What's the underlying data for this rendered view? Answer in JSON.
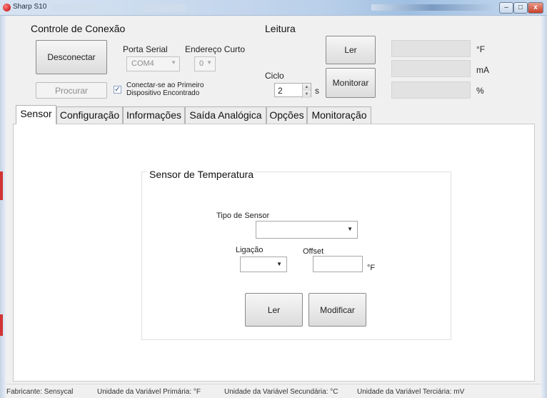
{
  "window": {
    "title": "Sharp S10",
    "controls": {
      "minimize": "–",
      "maximize": "□",
      "close": "x"
    }
  },
  "connection": {
    "group_title": "Controle de Conexão",
    "disconnect_label": "Desconectar",
    "search_label": "Procurar",
    "serial_port_label": "Porta Serial",
    "serial_port_value": "COM4",
    "short_address_label": "Endereço Curto",
    "short_address_value": "0",
    "connect_first_label_line1": "Conectar-se ao Primeiro",
    "connect_first_label_line2": "Dispositivo Encontrado",
    "connect_first_checked": true
  },
  "reading": {
    "group_title": "Leitura",
    "read_label": "Ler",
    "monitor_label": "Monitorar",
    "cycle_label": "Ciclo",
    "cycle_value": "2",
    "cycle_unit": "s",
    "units": [
      "°F",
      "mA",
      "%"
    ]
  },
  "tabs": [
    {
      "label": "Sensor",
      "active": true
    },
    {
      "label": "Configuração",
      "active": false
    },
    {
      "label": "Informações",
      "active": false
    },
    {
      "label": "Saída Analógica",
      "active": false
    },
    {
      "label": "Opções",
      "active": false
    },
    {
      "label": "Monitoração",
      "active": false
    }
  ],
  "sensor_panel": {
    "group_title": "Sensor de Temperatura",
    "sensor_type_label": "Tipo de Sensor",
    "sensor_type_value": "",
    "connection_label": "Ligação",
    "connection_value": "",
    "offset_label": "Offset",
    "offset_value": "",
    "offset_unit": "°F",
    "read_label": "Ler",
    "modify_label": "Modificar"
  },
  "status_bar": {
    "manufacturer": "Fabricante: Sensycal",
    "primary": "Unidade da Variável Primária: °F",
    "secondary": "Unidade da Variável Secundária: °C",
    "tertiary": "Unidade da Variável Terciária: mV"
  },
  "colors": {
    "accent_red": "#d23434",
    "window_bg": "#f0f0f0",
    "panel_bg": "#ffffff"
  }
}
